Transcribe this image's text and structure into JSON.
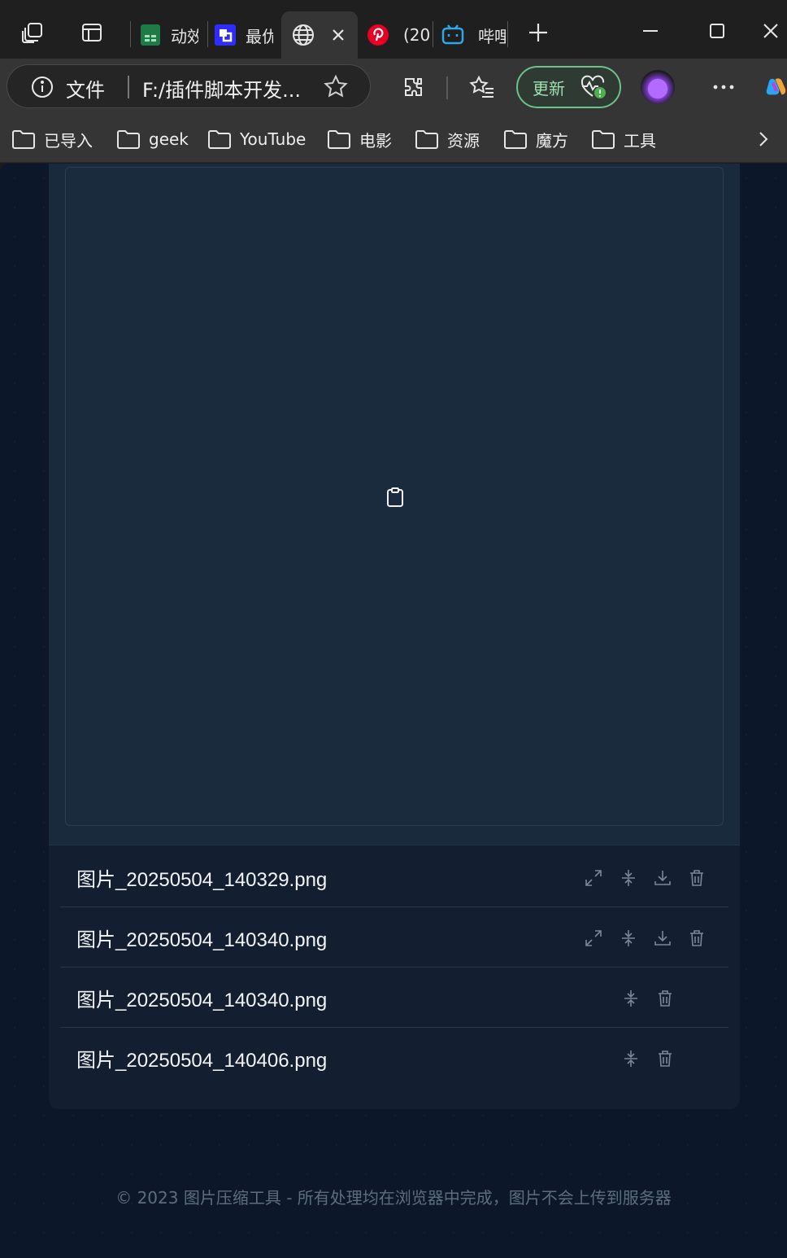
{
  "tabs": [
    {
      "title": "动效",
      "favicon": "spreadsheet-icon"
    },
    {
      "title": "最优",
      "favicon": "app-icon"
    },
    {
      "title": "",
      "favicon": "globe-icon",
      "active": true
    },
    {
      "title": "(20)",
      "favicon": "pinterest-icon"
    },
    {
      "title": "哔哩",
      "favicon": "bilibili-icon"
    }
  ],
  "address": {
    "security_label": "文件",
    "url": "F:/插件脚本开发..."
  },
  "toolbar": {
    "update_label": "更新"
  },
  "bookmarks": [
    "已导入",
    "geek",
    "YouTube",
    "电影",
    "资源",
    "魔方",
    "工具"
  ],
  "files": [
    {
      "name": "图片_20250504_140329.png",
      "actions": [
        "expand-icon",
        "compress-icon",
        "download-icon",
        "delete-icon"
      ]
    },
    {
      "name": "图片_20250504_140340.png",
      "actions": [
        "expand-icon",
        "compress-icon",
        "download-icon",
        "delete-icon"
      ]
    },
    {
      "name": "图片_20250504_140340.png",
      "actions": [
        "compress-icon",
        "delete-icon"
      ]
    },
    {
      "name": "图片_20250504_140406.png",
      "actions": [
        "compress-icon",
        "delete-icon"
      ]
    }
  ],
  "footer": "© 2023 图片压缩工具 - 所有处理均在浏览器中完成，图片不会上传到服务器",
  "colors": {
    "page_bg": "#0c1829",
    "card_bg": "#131f30",
    "dropzone_bg": "#1b2b3e",
    "update_accent": "#6cc28a"
  }
}
